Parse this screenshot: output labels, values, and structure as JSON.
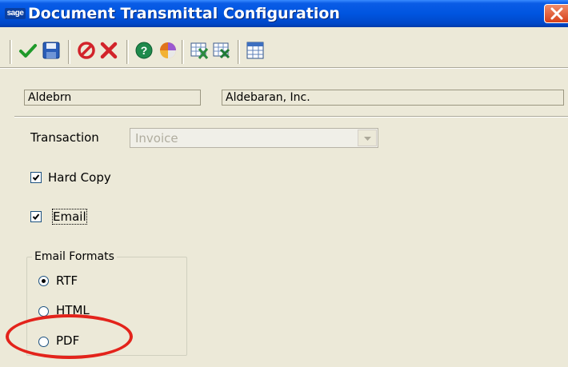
{
  "window": {
    "title": "Document Transmittal Configuration",
    "logo_text": "sage"
  },
  "toolbar": {
    "buttons": [
      {
        "icon": "checkmark-icon",
        "action": "accept"
      },
      {
        "icon": "save-disk-icon",
        "action": "save"
      },
      {
        "icon": "no-entry-icon",
        "action": "cancel"
      },
      {
        "icon": "delete-x-icon",
        "action": "delete"
      },
      {
        "icon": "help-icon",
        "action": "help"
      },
      {
        "icon": "color-wheel-icon",
        "action": "options"
      },
      {
        "icon": "print-grid-icon",
        "action": "print"
      },
      {
        "icon": "export-grid-icon",
        "action": "export"
      },
      {
        "icon": "table-icon",
        "action": "grid"
      }
    ]
  },
  "customer": {
    "code": "Aldebrn",
    "name": "Aldebaran, Inc."
  },
  "transaction": {
    "label": "Transaction",
    "value": "Invoice",
    "enabled": false
  },
  "hard_copy": {
    "label": "Hard Copy",
    "checked": true
  },
  "email": {
    "label": "Email",
    "checked": true
  },
  "email_formats": {
    "legend": "Email Formats",
    "options": [
      {
        "label": "RTF",
        "selected": true
      },
      {
        "label": "HTML",
        "selected": false
      },
      {
        "label": "PDF",
        "selected": false
      }
    ]
  },
  "colors": {
    "title_bar": "#0055e0",
    "window_bg": "#ece9d8",
    "highlight": "#e3231b"
  }
}
